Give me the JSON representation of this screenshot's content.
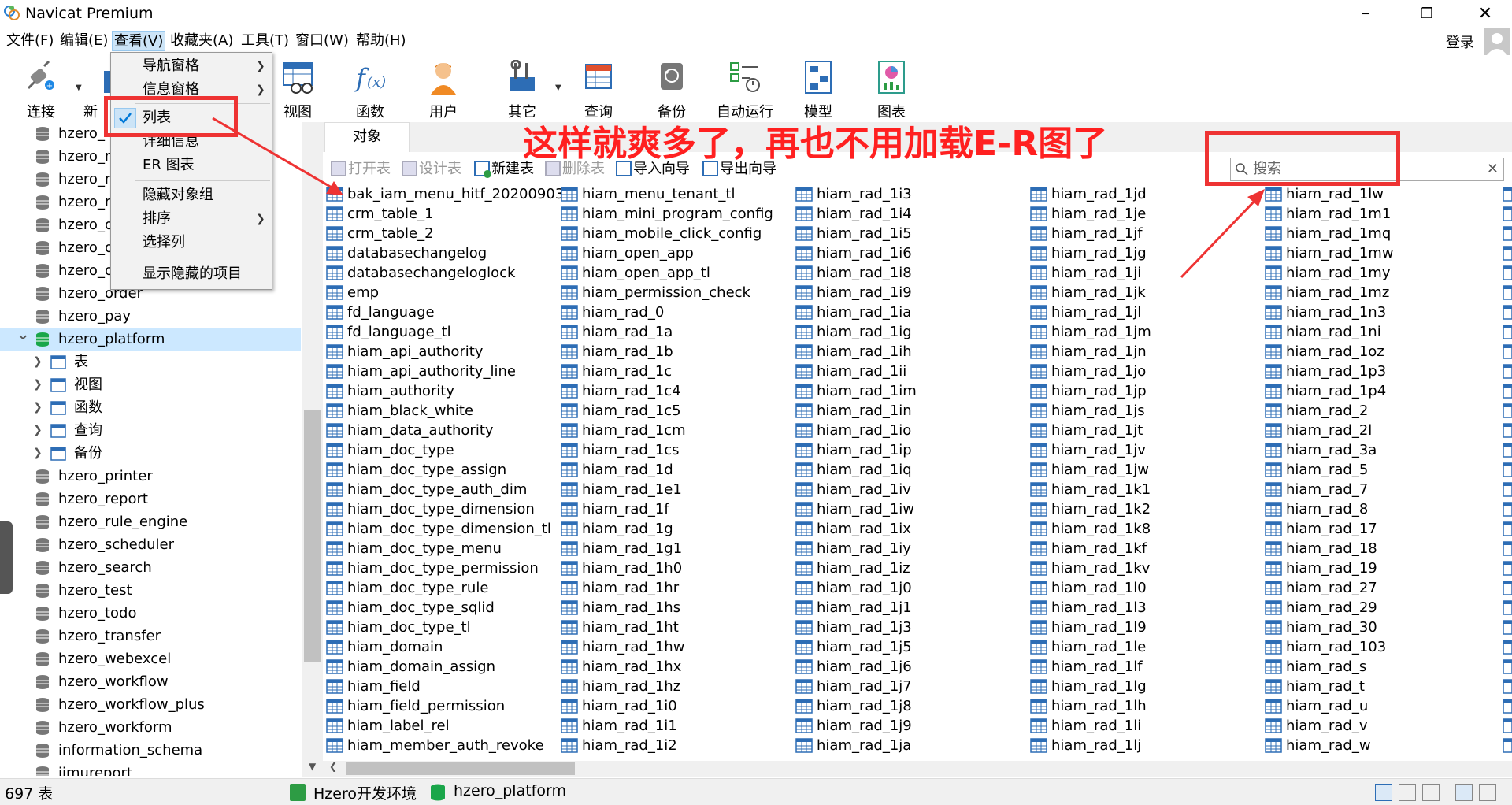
{
  "window": {
    "title": "Navicat Premium",
    "minimize": "─",
    "maximize": "❐",
    "close": "✕"
  },
  "menubar": {
    "items": [
      "文件(F)",
      "编辑(E)",
      "查看(V)",
      "收藏夹(A)",
      "工具(T)",
      "窗口(W)",
      "帮助(H)"
    ],
    "login": "登录"
  },
  "toolbar": {
    "items": [
      "连接",
      "新",
      "视图",
      "函数",
      "用户",
      "其它",
      "查询",
      "备份",
      "自动运行",
      "模型",
      "图表"
    ]
  },
  "view_menu": {
    "items": [
      "导航窗格",
      "信息窗格",
      "列表",
      "详细信息",
      "ER 图表",
      "隐藏对象组",
      "排序",
      "选择列",
      "显示隐藏的项目"
    ],
    "checked": "列表"
  },
  "nav": {
    "items": [
      "hzero_",
      "hzero_m",
      "hzero_m",
      "hzero_m",
      "hzero_o",
      "hzero_o",
      "hzero_o",
      "hzero_order",
      "hzero_pay",
      "hzero_platform",
      "表",
      "视图",
      "函数",
      "查询",
      "备份",
      "hzero_printer",
      "hzero_report",
      "hzero_rule_engine",
      "hzero_scheduler",
      "hzero_search",
      "hzero_test",
      "hzero_todo",
      "hzero_transfer",
      "hzero_webexcel",
      "hzero_workflow",
      "hzero_workflow_plus",
      "hzero_workform",
      "information_schema",
      "jimureport"
    ],
    "selected": "hzero_platform"
  },
  "object_tab": {
    "label": "对象"
  },
  "object_toolbar": {
    "open": "打开表",
    "design": "设计表",
    "new": "新建表",
    "delete": "删除表",
    "import": "导入向导",
    "export": "导出向导"
  },
  "search": {
    "placeholder": "搜索"
  },
  "tables": {
    "col1": [
      "bak_iam_menu_hitf_20200903",
      "crm_table_1",
      "crm_table_2",
      "databasechangelog",
      "databasechangeloglock",
      "emp",
      "fd_language",
      "fd_language_tl",
      "hiam_api_authority",
      "hiam_api_authority_line",
      "hiam_authority",
      "hiam_black_white",
      "hiam_data_authority",
      "hiam_doc_type",
      "hiam_doc_type_assign",
      "hiam_doc_type_auth_dim",
      "hiam_doc_type_dimension",
      "hiam_doc_type_dimension_tl",
      "hiam_doc_type_menu",
      "hiam_doc_type_permission",
      "hiam_doc_type_rule",
      "hiam_doc_type_sqlid",
      "hiam_doc_type_tl",
      "hiam_domain",
      "hiam_domain_assign",
      "hiam_field",
      "hiam_field_permission",
      "hiam_label_rel",
      "hiam_member_auth_revoke"
    ],
    "col2": [
      "hiam_menu_tenant_tl",
      "hiam_mini_program_config",
      "hiam_mobile_click_config",
      "hiam_open_app",
      "hiam_open_app_tl",
      "hiam_permission_check",
      "hiam_rad_0",
      "hiam_rad_1a",
      "hiam_rad_1b",
      "hiam_rad_1c",
      "hiam_rad_1c4",
      "hiam_rad_1c5",
      "hiam_rad_1cm",
      "hiam_rad_1cs",
      "hiam_rad_1d",
      "hiam_rad_1e1",
      "hiam_rad_1f",
      "hiam_rad_1g",
      "hiam_rad_1g1",
      "hiam_rad_1h0",
      "hiam_rad_1hr",
      "hiam_rad_1hs",
      "hiam_rad_1ht",
      "hiam_rad_1hw",
      "hiam_rad_1hx",
      "hiam_rad_1hz",
      "hiam_rad_1i0",
      "hiam_rad_1i1",
      "hiam_rad_1i2"
    ],
    "col3": [
      "hiam_rad_1i3",
      "hiam_rad_1i4",
      "hiam_rad_1i5",
      "hiam_rad_1i6",
      "hiam_rad_1i8",
      "hiam_rad_1i9",
      "hiam_rad_1ia",
      "hiam_rad_1ig",
      "hiam_rad_1ih",
      "hiam_rad_1ii",
      "hiam_rad_1im",
      "hiam_rad_1in",
      "hiam_rad_1io",
      "hiam_rad_1ip",
      "hiam_rad_1iq",
      "hiam_rad_1iv",
      "hiam_rad_1iw",
      "hiam_rad_1ix",
      "hiam_rad_1iy",
      "hiam_rad_1iz",
      "hiam_rad_1j0",
      "hiam_rad_1j1",
      "hiam_rad_1j3",
      "hiam_rad_1j5",
      "hiam_rad_1j6",
      "hiam_rad_1j7",
      "hiam_rad_1j8",
      "hiam_rad_1j9",
      "hiam_rad_1ja"
    ],
    "col4": [
      "hiam_rad_1jd",
      "hiam_rad_1je",
      "hiam_rad_1jf",
      "hiam_rad_1jg",
      "hiam_rad_1ji",
      "hiam_rad_1jk",
      "hiam_rad_1jl",
      "hiam_rad_1jm",
      "hiam_rad_1jn",
      "hiam_rad_1jo",
      "hiam_rad_1jp",
      "hiam_rad_1js",
      "hiam_rad_1jt",
      "hiam_rad_1jv",
      "hiam_rad_1jw",
      "hiam_rad_1k1",
      "hiam_rad_1k2",
      "hiam_rad_1k8",
      "hiam_rad_1kf",
      "hiam_rad_1kv",
      "hiam_rad_1l0",
      "hiam_rad_1l3",
      "hiam_rad_1l9",
      "hiam_rad_1le",
      "hiam_rad_1lf",
      "hiam_rad_1lg",
      "hiam_rad_1lh",
      "hiam_rad_1li",
      "hiam_rad_1lj"
    ],
    "col5": [
      "hiam_rad_1lw",
      "hiam_rad_1m1",
      "hiam_rad_1mq",
      "hiam_rad_1mw",
      "hiam_rad_1my",
      "hiam_rad_1mz",
      "hiam_rad_1n3",
      "hiam_rad_1ni",
      "hiam_rad_1oz",
      "hiam_rad_1p3",
      "hiam_rad_1p4",
      "hiam_rad_2",
      "hiam_rad_2l",
      "hiam_rad_3a",
      "hiam_rad_5",
      "hiam_rad_7",
      "hiam_rad_8",
      "hiam_rad_17",
      "hiam_rad_18",
      "hiam_rad_19",
      "hiam_rad_27",
      "hiam_rad_29",
      "hiam_rad_30",
      "hiam_rad_103",
      "hiam_rad_s",
      "hiam_rad_t",
      "hiam_rad_u",
      "hiam_rad_v",
      "hiam_rad_w"
    ]
  },
  "status": {
    "count": "697 表",
    "connection": "Hzero开发环境",
    "database": "hzero_platform"
  },
  "annotation": {
    "text": "这样就爽多了，再也不用加载E-R图了"
  },
  "colors": {
    "accent": "#0078d7",
    "annotation": "#ee3333",
    "selected": "#cce8ff",
    "db_green": "#1aa64a"
  }
}
